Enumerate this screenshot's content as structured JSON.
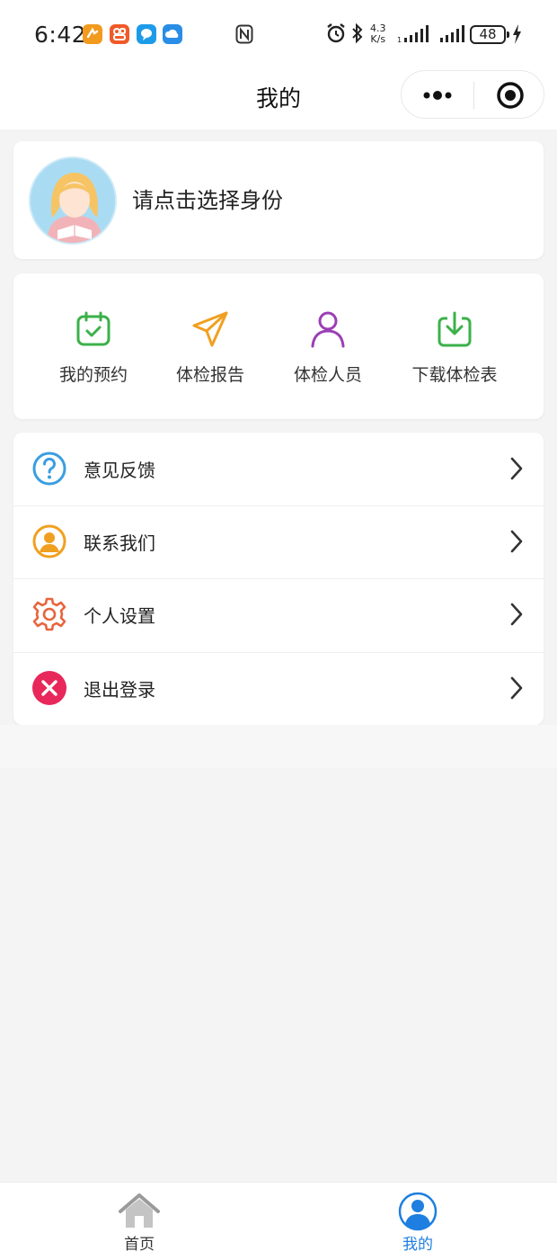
{
  "status_bar": {
    "time": "6:42",
    "net_speed_value": "4.3",
    "net_speed_unit": "K/s",
    "battery": "48"
  },
  "nav": {
    "title": "我的"
  },
  "profile": {
    "prompt": "请点击选择身份"
  },
  "quick_actions": [
    {
      "label": "我的预约",
      "icon": "calendar-check-icon",
      "color": "#3bb14a"
    },
    {
      "label": "体检报告",
      "icon": "paper-plane-icon",
      "color": "#f0a020"
    },
    {
      "label": "体检人员",
      "icon": "person-icon",
      "color": "#9b3fb5"
    },
    {
      "label": "下载体检表",
      "icon": "download-tray-icon",
      "color": "#3bb14a"
    }
  ],
  "menu": [
    {
      "label": "意见反馈",
      "icon": "question-circle-icon",
      "color": "#3a9ee0"
    },
    {
      "label": "联系我们",
      "icon": "user-circle-icon",
      "color": "#f0a020"
    },
    {
      "label": "个人设置",
      "icon": "gear-icon",
      "color": "#e8643c"
    },
    {
      "label": "退出登录",
      "icon": "close-circle-icon",
      "color": "#e8275a"
    }
  ],
  "tabs": [
    {
      "label": "首页",
      "icon": "home-icon",
      "active": false,
      "color": "#333333"
    },
    {
      "label": "我的",
      "icon": "profile-icon",
      "active": true,
      "color": "#1e7fe0"
    }
  ]
}
